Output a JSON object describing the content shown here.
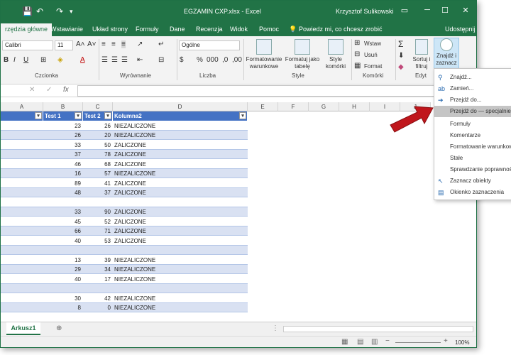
{
  "window": {
    "title": "EGZAMIN CXP.xlsx - Excel",
    "user": "Krzysztof Sulikowski"
  },
  "tabs": [
    "rzędzia główne",
    "Wstawianie",
    "Układ strony",
    "Formuły",
    "Dane",
    "Recenzja",
    "Widok",
    "Pomoc",
    "Powiedz mi, co chcesz zrobić",
    "Udostępnij"
  ],
  "ribbon": {
    "font_name": "Calibri",
    "font_size": "11",
    "number_format": "Ogólne",
    "groups": {
      "font": "Czcionka",
      "align": "Wyrównanie",
      "number": "Liczba",
      "styles": "Style",
      "cells": "Komórki",
      "edit": "Edyt"
    },
    "styles_buttons": [
      "Formatowanie warunkowe",
      "Formatuj jako tabelę",
      "Style komórki"
    ],
    "cells_buttons": [
      "Wstaw",
      "Usuń",
      "Format"
    ],
    "sort_label": "Sortuj i filtruj",
    "find_label": "Znajdź i zaznacz"
  },
  "formula_bar": {
    "fx": "fx"
  },
  "columns": [
    "A",
    "B",
    "C",
    "D",
    "E",
    "F",
    "G",
    "H",
    "I",
    "J"
  ],
  "table": {
    "headers": [
      "",
      "Test 1",
      "Test 2",
      "Kolumna2"
    ],
    "rows": [
      [
        "23",
        "26",
        "NIEZALICZONE"
      ],
      [
        "26",
        "20",
        "NIEZALICZONE"
      ],
      [
        "33",
        "50",
        "ZALICZONE"
      ],
      [
        "37",
        "78",
        "ZALICZONE"
      ],
      [
        "46",
        "68",
        "ZALICZONE"
      ],
      [
        "16",
        "57",
        "NIEZALICZONE"
      ],
      [
        "89",
        "41",
        "ZALICZONE"
      ],
      [
        "48",
        "37",
        "ZALICZONE"
      ],
      [
        "",
        "",
        ""
      ],
      [
        "33",
        "90",
        "ZALICZONE"
      ],
      [
        "45",
        "52",
        "ZALICZONE"
      ],
      [
        "66",
        "71",
        "ZALICZONE"
      ],
      [
        "40",
        "53",
        "ZALICZONE"
      ],
      [
        "",
        "",
        ""
      ],
      [
        "13",
        "39",
        "NIEZALICZONE"
      ],
      [
        "29",
        "34",
        "NIEZALICZONE"
      ],
      [
        "40",
        "17",
        "NIEZALICZONE"
      ],
      [
        "",
        "",
        ""
      ],
      [
        "30",
        "42",
        "NIEZALICZONE"
      ],
      [
        "8",
        "0",
        "NIEZALICZONE"
      ]
    ]
  },
  "menu": [
    "Znajdź...",
    "Zamień...",
    "Przejdź do...",
    "Przejdź do — specjalnie...",
    "Formuły",
    "Komentarze",
    "Formatowanie warunkowe",
    "Stałe",
    "Sprawdzanie poprawności",
    "Zaznacz obiekty",
    "Okienko zaznaczenia"
  ],
  "sheet_tab": "Arkusz1",
  "zoom": "100%",
  "colors": {
    "excel_green": "#217346",
    "band": "#d9e1f2",
    "header_blue": "#4472c4"
  }
}
